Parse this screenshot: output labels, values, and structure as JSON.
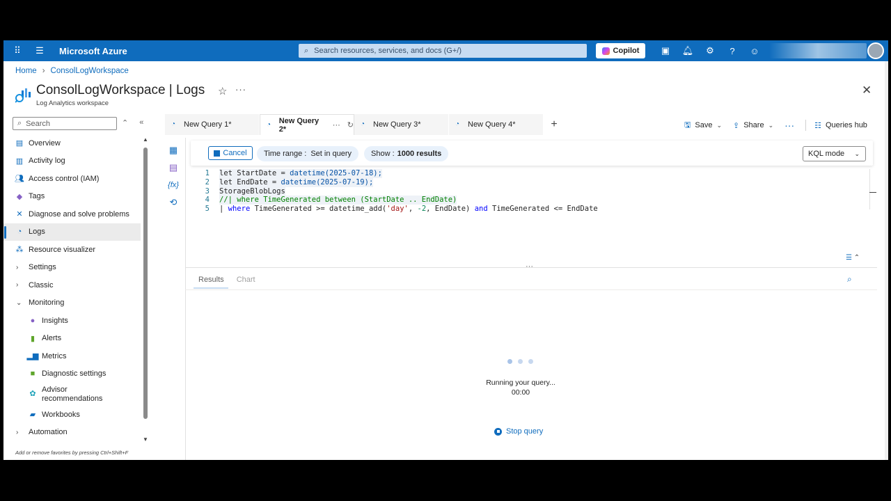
{
  "topbar": {
    "brand": "Microsoft Azure",
    "search_placeholder": "Search resources, services, and docs (G+/)",
    "copilot_label": "Copilot",
    "icons": [
      "waffle-icon",
      "hamburger-icon",
      "search-icon",
      "terminal-icon",
      "bell-icon",
      "gear-icon",
      "help-icon",
      "feedback-icon"
    ]
  },
  "breadcrumb": {
    "home": "Home",
    "workspace": "ConsolLogWorkspace"
  },
  "header": {
    "title": "ConsolLogWorkspace | Logs",
    "subtitle": "Log Analytics workspace"
  },
  "sidebar": {
    "search_placeholder": "Search",
    "items": [
      {
        "label": "Overview"
      },
      {
        "label": "Activity log"
      },
      {
        "label": "Access control (IAM)"
      },
      {
        "label": "Tags"
      },
      {
        "label": "Diagnose and solve problems"
      },
      {
        "label": "Logs"
      },
      {
        "label": "Resource visualizer"
      },
      {
        "label": "Settings"
      },
      {
        "label": "Classic"
      },
      {
        "label": "Monitoring"
      },
      {
        "label": "Insights"
      },
      {
        "label": "Alerts"
      },
      {
        "label": "Metrics"
      },
      {
        "label": "Diagnostic settings"
      },
      {
        "label": "Advisor recommendations"
      },
      {
        "label": "Workbooks"
      },
      {
        "label": "Automation"
      }
    ],
    "footer": "Add or remove favorites by pressing Ctrl+Shift+F"
  },
  "tabs": [
    {
      "label": "New Query 1*"
    },
    {
      "label": "New Query 2*"
    },
    {
      "label": "New Query 3*"
    },
    {
      "label": "New Query 4*"
    }
  ],
  "toolbar": {
    "save": "Save",
    "share": "Share",
    "queries_hub": "Queries hub"
  },
  "query_bar": {
    "cancel": "Cancel",
    "time_range_label": "Time range :",
    "time_range_value": "Set in query",
    "show_label": "Show :",
    "show_value": "1000 results",
    "mode": "KQL mode"
  },
  "editor": {
    "line_numbers": [
      "1",
      "2",
      "3",
      "4",
      "5"
    ],
    "l1": {
      "a": "let StartDate = ",
      "b": "datetime(2025-07-18);"
    },
    "l2": {
      "a": "let EndDate = ",
      "b": "datetime(2025-07-19);"
    },
    "l3": "StorageBlobLogs",
    "l4": "//| where TimeGenerated between (StartDate .. EndDate)",
    "l5": {
      "pipe": "| ",
      "where": "where",
      "a": " TimeGenerated >= datetime_add(",
      "s": "'day'",
      "c": ", ",
      "n": "-2",
      "d": ", EndDate) ",
      "and": "and",
      "e": " TimeGenerated <= EndDate"
    }
  },
  "results": {
    "tab_results": "Results",
    "tab_chart": "Chart",
    "running": "Running your query...",
    "timer": "00:00",
    "stop": "Stop query"
  }
}
